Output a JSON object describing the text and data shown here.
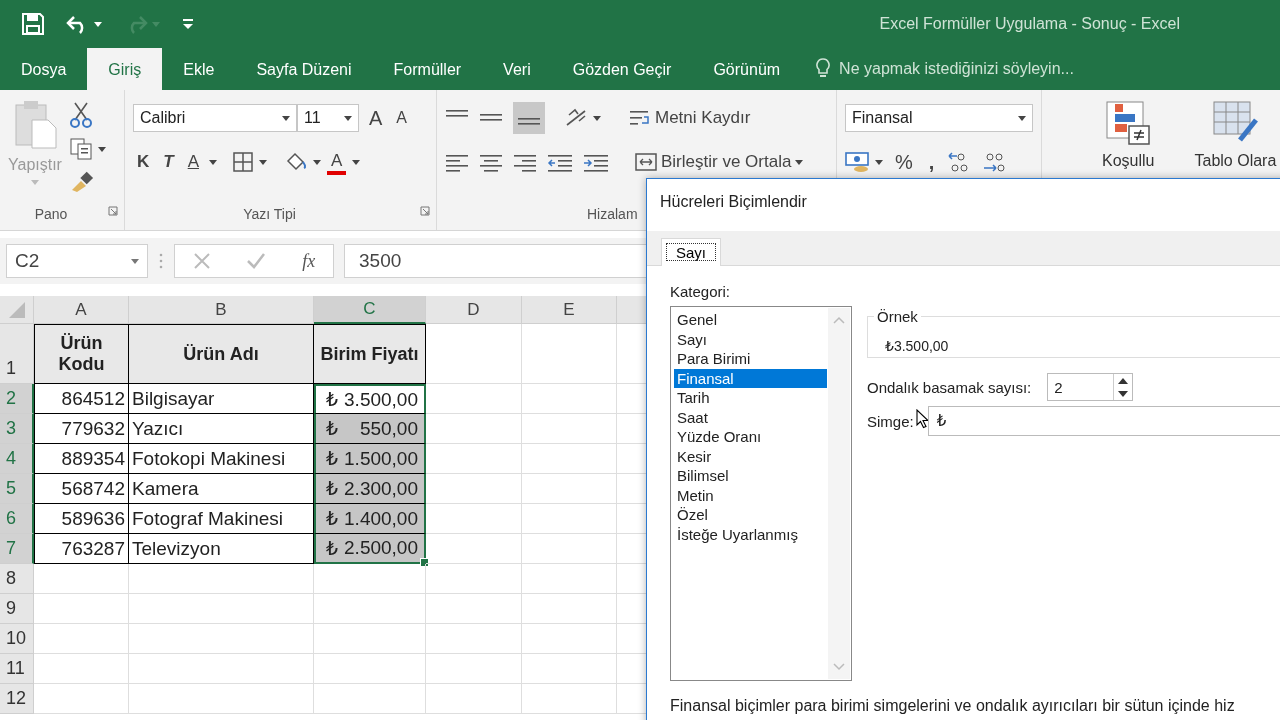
{
  "window": {
    "title": "Excel Formüller Uygulama - Sonuç - Excel"
  },
  "tabs": [
    {
      "label": "Dosya",
      "selected": false
    },
    {
      "label": "Giriş",
      "selected": true
    },
    {
      "label": "Ekle",
      "selected": false
    },
    {
      "label": "Sayfa Düzeni",
      "selected": false
    },
    {
      "label": "Formüller",
      "selected": false
    },
    {
      "label": "Veri",
      "selected": false
    },
    {
      "label": "Gözden Geçir",
      "selected": false
    },
    {
      "label": "Görünüm",
      "selected": false
    }
  ],
  "tell_me": {
    "placeholder": "Ne yapmak istediğinizi söyleyin..."
  },
  "ribbon": {
    "paste": "Yapıştır",
    "font_name": "Calibri",
    "font_size": "11",
    "grow": "A",
    "shrink": "A",
    "bold": "K",
    "italic": "T",
    "underline": "A",
    "font_color": "A",
    "wrap_text": "Metni Kaydır",
    "merge_center": "Birleştir ve Ortala",
    "number_format": "Finansal",
    "percent": "%",
    "comma": ",",
    "conditional": "Koşullu",
    "table_format": "Tablo Olara",
    "groups": [
      "Pano",
      "Yazı Tipi",
      "Hizalam"
    ]
  },
  "formula_bar": {
    "name_box": "C2",
    "function_label": "fx",
    "formula": "3500"
  },
  "sheet": {
    "columns": [
      {
        "label": "A",
        "selected": false
      },
      {
        "label": "B",
        "selected": false
      },
      {
        "label": "C",
        "selected": true
      },
      {
        "label": "D",
        "selected": false
      },
      {
        "label": "E",
        "selected": false
      }
    ],
    "rows": [
      {
        "label": "1",
        "kind": "header",
        "selected": false,
        "code": "Ürün Kodu",
        "name": "Ürün Adı",
        "price": "Birim Fiyatı"
      },
      {
        "label": "2",
        "kind": "data",
        "selected": true,
        "active": true,
        "code": "864512",
        "name": "Bilgisayar",
        "symbol": "₺",
        "price": "3.500,00"
      },
      {
        "label": "3",
        "kind": "data",
        "selected": true,
        "active": false,
        "code": "779632",
        "name": "Yazıcı",
        "symbol": "₺",
        "price": "550,00"
      },
      {
        "label": "4",
        "kind": "data",
        "selected": true,
        "active": false,
        "code": "889354",
        "name": "Fotokopi Makinesi",
        "symbol": "₺",
        "price": "1.500,00"
      },
      {
        "label": "5",
        "kind": "data",
        "selected": true,
        "active": false,
        "code": "568742",
        "name": "Kamera",
        "symbol": "₺",
        "price": "2.300,00"
      },
      {
        "label": "6",
        "kind": "data",
        "selected": true,
        "active": false,
        "code": "589636",
        "name": "Fotograf Makinesi",
        "symbol": "₺",
        "price": "1.400,00"
      },
      {
        "label": "7",
        "kind": "data",
        "selected": true,
        "active": false,
        "code": "763287",
        "name": "Televizyon",
        "symbol": "₺",
        "price": "2.500,00"
      },
      {
        "label": "8",
        "kind": "empty",
        "selected": false
      },
      {
        "label": "9",
        "kind": "empty",
        "selected": false
      },
      {
        "label": "10",
        "kind": "empty",
        "selected": false
      },
      {
        "label": "11",
        "kind": "empty",
        "selected": false
      },
      {
        "label": "12",
        "kind": "empty",
        "selected": false
      }
    ]
  },
  "dialog": {
    "title": "Hücreleri Biçimlendir",
    "tabs": [
      {
        "label": "Sayı",
        "selected": true
      }
    ],
    "category_label": "Kategori:",
    "categories": [
      {
        "label": "Genel",
        "selected": false
      },
      {
        "label": "Sayı",
        "selected": false
      },
      {
        "label": "Para Birimi",
        "selected": false
      },
      {
        "label": "Finansal",
        "selected": true
      },
      {
        "label": "Tarih",
        "selected": false
      },
      {
        "label": "Saat",
        "selected": false
      },
      {
        "label": "Yüzde Oranı",
        "selected": false
      },
      {
        "label": "Kesir",
        "selected": false
      },
      {
        "label": "Bilimsel",
        "selected": false
      },
      {
        "label": "Metin",
        "selected": false
      },
      {
        "label": "Özel",
        "selected": false
      },
      {
        "label": "İsteğe Uyarlanmış",
        "selected": false
      }
    ],
    "sample_label": "Örnek",
    "sample": "₺3.500,00",
    "decimals_label": "Ondalık basamak sayısı:",
    "decimals": "2",
    "symbol_label": "Simge:",
    "symbol": "₺",
    "description": "Finansal biçimler para birimi simgelerini ve ondalık ayırıcıları bir sütun içinde hiz"
  }
}
